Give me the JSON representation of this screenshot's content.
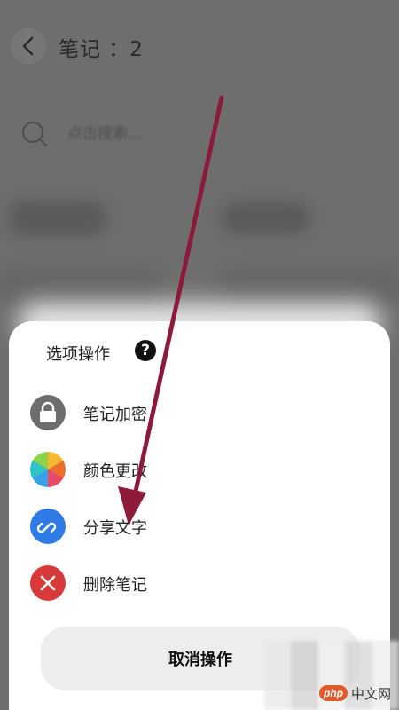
{
  "background_page": {
    "title": "笔记 ：2",
    "search_placeholder": "点击搜索..."
  },
  "sheet": {
    "title": "选项操作",
    "help_glyph": "?",
    "items": [
      {
        "label": "笔记加密",
        "icon": "lock-icon"
      },
      {
        "label": "颜色更改",
        "icon": "color-wheel-icon"
      },
      {
        "label": "分享文字",
        "icon": "link-icon"
      },
      {
        "label": "删除笔记",
        "icon": "delete-x-icon"
      }
    ],
    "cancel_label": "取消操作"
  },
  "watermark": {
    "badge": "php",
    "site": "中文网"
  },
  "colors": {
    "dim_background": "#6e6e6e",
    "sheet": "#ffffff",
    "lock": "#6d6d6d",
    "share": "#2e7be6",
    "delete": "#d83a3a",
    "cancel_button": "#ededed",
    "annotation_arrow": "#8e1a3a"
  }
}
